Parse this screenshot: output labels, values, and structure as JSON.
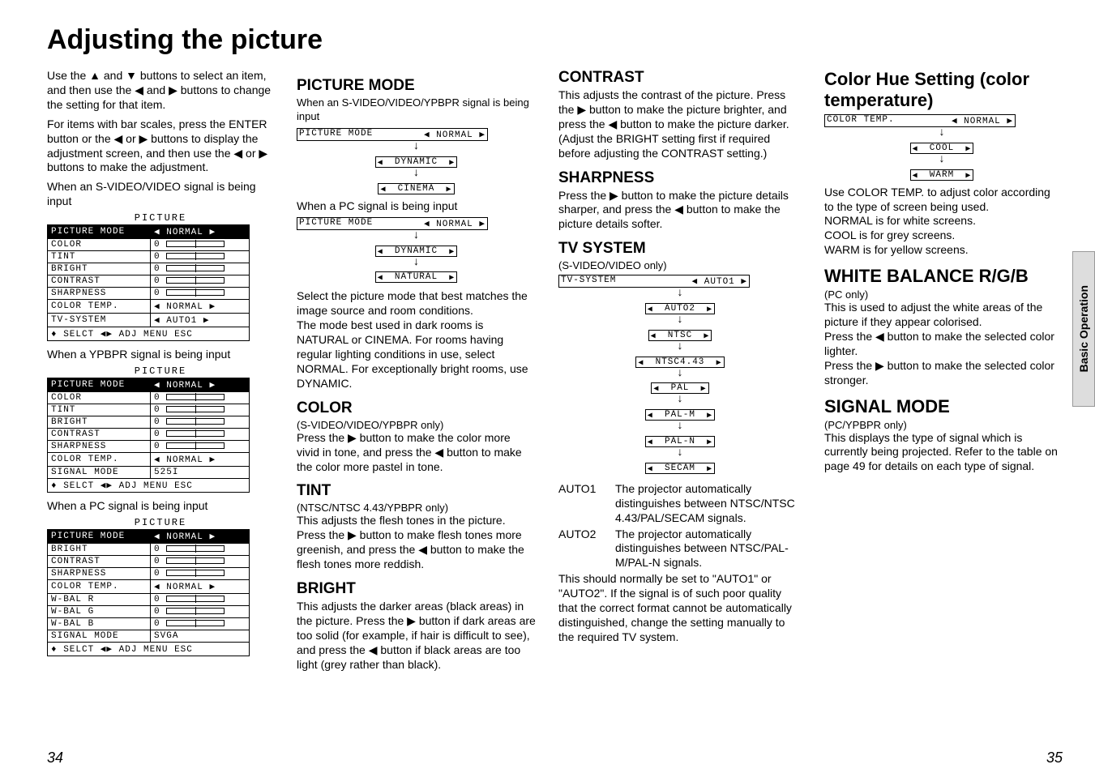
{
  "title": "Adjusting the picture",
  "intro": {
    "p1": "Use the ▲ and ▼ buttons to select an item, and then use the ◀ and ▶ buttons to change the setting for that item.",
    "p2": "For items with bar scales, press the ENTER button or the ◀ or ▶ buttons to display the adjustment screen, and then use the ◀ or ▶ buttons to make the adjustment.",
    "cap1": "When an S-VIDEO/VIDEO signal is being input",
    "cap2": "When a YPBPR signal is being input",
    "cap3": "When a PC signal is being input"
  },
  "osd_title": "PICTURE",
  "osd1": [
    {
      "label": "PICTURE MODE",
      "val": "◀ NORMAL  ▶",
      "hl": true,
      "slider": false
    },
    {
      "label": "COLOR",
      "val": "0",
      "slider": true
    },
    {
      "label": "TINT",
      "val": "0",
      "slider": true
    },
    {
      "label": "BRIGHT",
      "val": "0",
      "slider": true
    },
    {
      "label": "CONTRAST",
      "val": "0",
      "slider": true
    },
    {
      "label": "SHARPNESS",
      "val": "0",
      "slider": true
    },
    {
      "label": "COLOR TEMP.",
      "val": "◀ NORMAL  ▶",
      "slider": false
    },
    {
      "label": "TV-SYSTEM",
      "val": "◀ AUTO1   ▶",
      "slider": false
    }
  ],
  "osd_footer": "♦ SELCT ◀▶ ADJ     MENU ESC",
  "osd2": [
    {
      "label": "PICTURE MODE",
      "val": "◀ NORMAL  ▶",
      "hl": true,
      "slider": false
    },
    {
      "label": "COLOR",
      "val": "0",
      "slider": true
    },
    {
      "label": "TINT",
      "val": "0",
      "slider": true
    },
    {
      "label": "BRIGHT",
      "val": "0",
      "slider": true
    },
    {
      "label": "CONTRAST",
      "val": "0",
      "slider": true
    },
    {
      "label": "SHARPNESS",
      "val": "0",
      "slider": true
    },
    {
      "label": "COLOR TEMP.",
      "val": "◀ NORMAL  ▶",
      "slider": false
    },
    {
      "label": "SIGNAL MODE",
      "val": "  525I",
      "slider": false
    }
  ],
  "osd3": [
    {
      "label": "PICTURE MODE",
      "val": "◀ NORMAL  ▶",
      "hl": true,
      "slider": false
    },
    {
      "label": "BRIGHT",
      "val": "0",
      "slider": true
    },
    {
      "label": "CONTRAST",
      "val": "0",
      "slider": true
    },
    {
      "label": "SHARPNESS",
      "val": "0",
      "slider": true
    },
    {
      "label": "COLOR TEMP.",
      "val": "◀ NORMAL  ▶",
      "slider": false
    },
    {
      "label": "W-BAL  R",
      "val": "0",
      "slider": true
    },
    {
      "label": "W-BAL  G",
      "val": "0",
      "slider": true
    },
    {
      "label": "W-BAL  B",
      "val": "0",
      "slider": true
    },
    {
      "label": "SIGNAL MODE",
      "val": "  SVGA",
      "slider": false
    }
  ],
  "pm": {
    "h": "PICTURE MODE",
    "cap_sv": "When an S-VIDEO/VIDEO/YPBPR signal is being input",
    "flow_sv_label": "PICTURE MODE",
    "flow_sv": [
      "NORMAL",
      "DYNAMIC",
      "CINEMA"
    ],
    "cap_pc": "When a PC signal is being input",
    "flow_pc": [
      "NORMAL",
      "DYNAMIC",
      "NATURAL"
    ],
    "body": "Select the picture mode that best matches the image source and room conditions.\nThe mode best used in dark rooms is NATURAL or CINEMA. For rooms having regular lighting conditions in use, select NORMAL. For exceptionally bright rooms, use DYNAMIC."
  },
  "color": {
    "h": "COLOR",
    "sub": "(S-VIDEO/VIDEO/YPBPR only)",
    "body": "Press the ▶ button to make the color more vivid in tone, and press the ◀ button to make the color more pastel in tone."
  },
  "tint": {
    "h": "TINT",
    "sub": "(NTSC/NTSC 4.43/YPBPR only)",
    "body": "This adjusts the flesh tones in the picture. Press the ▶ button to make flesh tones more greenish, and press the ◀ button to make the flesh tones more reddish."
  },
  "bright": {
    "h": "BRIGHT",
    "body": "This adjusts the darker areas (black areas) in the picture. Press the ▶ button if dark areas are too solid (for example, if hair is difficult to see), and press the ◀ button if black areas are too light (grey rather than black)."
  },
  "contrast": {
    "h": "CONTRAST",
    "body": "This adjusts the contrast of the picture. Press the ▶ button to make the picture brighter, and press the ◀ button to make the picture darker. (Adjust the BRIGHT setting first if required before adjusting the CONTRAST setting.)"
  },
  "sharp": {
    "h": "SHARPNESS",
    "body": "Press the ▶ button to make the picture details sharper, and press the ◀ button to make the picture details softer."
  },
  "tv": {
    "h": "TV SYSTEM",
    "sub": "(S-VIDEO/VIDEO only)",
    "flow_label": "TV-SYSTEM",
    "flow": [
      "AUTO1",
      "AUTO2",
      "NTSC",
      "NTSC4.43",
      "PAL",
      "PAL-M",
      "PAL-N",
      "SECAM"
    ],
    "defs": [
      {
        "k": "AUTO1",
        "v": "The projector automatically distinguishes between NTSC/NTSC 4.43/PAL/SECAM signals."
      },
      {
        "k": "AUTO2",
        "v": "The projector automatically distinguishes between NTSC/PAL-M/PAL-N signals."
      }
    ],
    "note": "This should normally be set to \"AUTO1\" or \"AUTO2\". If the signal is of such poor quality that the correct format cannot be automatically distinguished, change the setting manually to the required TV system."
  },
  "colortemp": {
    "h": "Color Hue Setting (color temperature)",
    "flow_label": "COLOR TEMP.",
    "flow": [
      "NORMAL",
      "COOL",
      "WARM"
    ],
    "body": "Use COLOR TEMP. to adjust color according to the type of screen being used.\nNORMAL is for white screens.\nCOOL is for grey screens.\nWARM is for yellow screens."
  },
  "wb": {
    "h": "WHITE BALANCE R/G/B",
    "sub": "(PC only)",
    "body": "This is used to adjust the white areas of the picture if they appear colorised.\nPress the ◀ button to make the selected color lighter.\nPress the ▶ button to make the selected color stronger."
  },
  "sig": {
    "h": "SIGNAL MODE",
    "sub": "(PC/YPBPR only)",
    "body": "This displays the type of signal which is currently being projected. Refer to the table on page 49 for details on each type of signal."
  },
  "sidetab": "Basic Operation",
  "page_left": "34",
  "page_right": "35"
}
